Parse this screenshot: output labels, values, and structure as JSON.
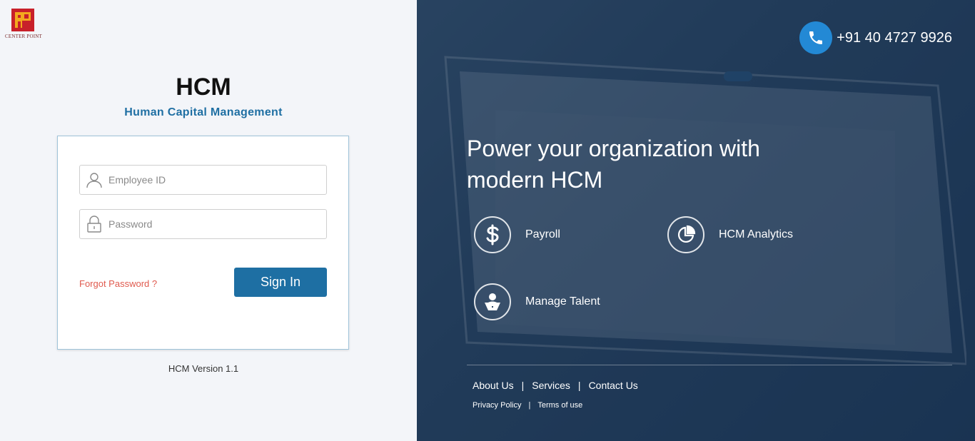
{
  "brand": {
    "logo_text": "CENTER POINT"
  },
  "login": {
    "title": "HCM",
    "subtitle": "Human Capital Management",
    "employee_placeholder": "Employee ID",
    "password_placeholder": "Password",
    "forgot_label": "Forgot Password ?",
    "signin_label": "Sign In",
    "version": "HCM Version 1.1"
  },
  "promo": {
    "phone": "+91 40 4727 9926",
    "headline": "Power your organization with modern HCM",
    "features": [
      {
        "label": "Payroll",
        "icon": "dollar-icon"
      },
      {
        "label": "HCM Analytics",
        "icon": "pie-chart-icon"
      },
      {
        "label": "Manage Talent",
        "icon": "person-laptop-icon"
      }
    ]
  },
  "footer": {
    "links": [
      "About Us",
      "Services",
      "Contact Us"
    ],
    "sub_links": [
      "Privacy Policy",
      "Terms of use"
    ],
    "separator": "|"
  },
  "colors": {
    "accent": "#1e6fa3",
    "subtitle": "#1f6fa3",
    "forgot": "#e05a4e",
    "phone_circle": "#2389d5"
  }
}
